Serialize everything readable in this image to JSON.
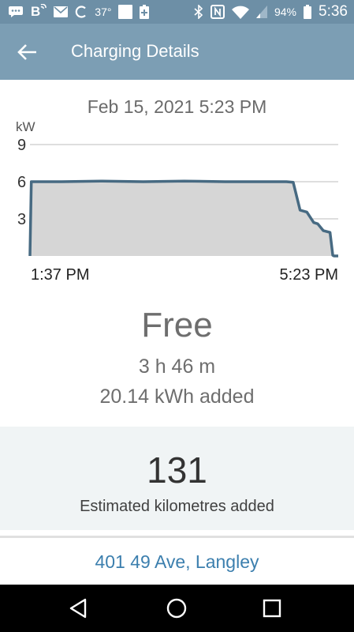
{
  "status_bar": {
    "temperature": "37°",
    "battery_percent": "94%",
    "time": "5:36",
    "icons": [
      "chat-icon",
      "bluetooth-badge-icon",
      "mail-icon",
      "sync-icon",
      "temperature-icon",
      "blank-notification-icon",
      "battery-saver-icon",
      "bluetooth-icon",
      "nfc-icon",
      "wifi-icon",
      "signal-icon",
      "battery-icon"
    ],
    "bluetooth_badge": "B"
  },
  "app_bar": {
    "title": "Charging Details",
    "back_icon": "arrow-left-icon",
    "background_color": "#7c9eb4"
  },
  "session": {
    "date": "Feb 15, 2021 5:23 PM",
    "cost": "Free",
    "duration": "3 h 46 m",
    "energy": "20.14 kWh added"
  },
  "chart_data": {
    "type": "area",
    "ylabel": "kW",
    "y_ticks": [
      "3",
      "6",
      "9"
    ],
    "ylim": [
      0,
      9
    ],
    "x_labels": [
      "1:37 PM",
      "5:23 PM"
    ],
    "x": [
      "1:37 PM",
      "1:38 PM",
      "1:40 PM",
      "2:00 PM",
      "2:30 PM",
      "3:00 PM",
      "3:30 PM",
      "4:00 PM",
      "4:30 PM",
      "4:45 PM",
      "4:50 PM",
      "4:55 PM",
      "5:00 PM",
      "5:05 PM",
      "5:08 PM",
      "5:12 PM",
      "5:17 PM",
      "5:19 PM",
      "5:20 PM",
      "5:23 PM"
    ],
    "values": [
      0,
      6.0,
      6.0,
      6.0,
      6.05,
      6.0,
      6.05,
      6.0,
      6.0,
      6.0,
      5.95,
      3.7,
      3.55,
      2.7,
      2.6,
      2.05,
      1.9,
      0.05,
      0.0,
      0.0
    ],
    "grid": true,
    "fill_color": "#d6d6d6",
    "line_color": "#476a82"
  },
  "estimate": {
    "value": "131",
    "label": "Estimated kilometres added"
  },
  "location": {
    "address": "401 49 Ave, Langley"
  },
  "nav_bar": {
    "buttons": [
      "back-triangle-icon",
      "home-circle-icon",
      "recents-square-icon"
    ]
  }
}
